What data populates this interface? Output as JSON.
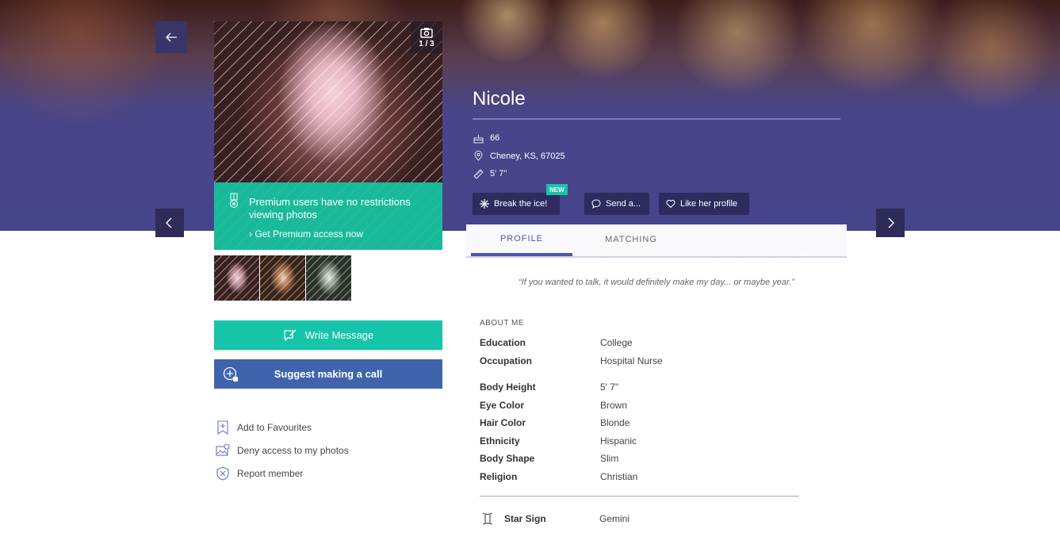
{
  "profile": {
    "name": "Nicole",
    "age": "66",
    "location": "Cheney, KS, 67025",
    "height": "5' 7\""
  },
  "photo": {
    "counter": "1 / 3",
    "thumbnail_count": 3
  },
  "premium": {
    "text": "Premium users have no restrictions viewing photos",
    "link": "Get Premium access now"
  },
  "buttons": {
    "write_message": "Write Message",
    "suggest_call": "Suggest making a call",
    "break_ice": "Break the ice!",
    "new_badge": "NEW",
    "send": "Send a...",
    "like": "Like her profile"
  },
  "actions": [
    {
      "label": "Add to Favourites",
      "icon": "bookmark-plus-icon"
    },
    {
      "label": "Deny access to my photos",
      "icon": "photo-lock-icon"
    },
    {
      "label": "Report member",
      "icon": "shield-x-icon"
    }
  ],
  "tabs": [
    {
      "label": "PROFILE",
      "active": true
    },
    {
      "label": "MATCHING",
      "active": false
    }
  ],
  "quote": "“If you wanted to talk, it would definitely make my day... or maybe year.”",
  "about": {
    "heading": "ABOUT ME",
    "group1": [
      {
        "key": "Education",
        "value": "College"
      },
      {
        "key": "Occupation",
        "value": "Hospital Nurse"
      }
    ],
    "group2": [
      {
        "key": "Body Height",
        "value": "5' 7\""
      },
      {
        "key": "Eye Color",
        "value": "Brown"
      },
      {
        "key": "Hair Color",
        "value": "Blonde"
      },
      {
        "key": "Ethnicity",
        "value": "Hispanic"
      },
      {
        "key": "Body Shape",
        "value": "Slim"
      },
      {
        "key": "Religion",
        "value": "Christian"
      }
    ],
    "star_sign": {
      "key": "Star Sign",
      "value": "Gemini",
      "icon": "gemini-icon"
    }
  },
  "colors": {
    "hero_blue": "#46448a",
    "teal": "#16c4aa",
    "call_blue": "#3f64ae",
    "dark_pill": "#2e2b5e",
    "tab_active": "#4c55b0"
  }
}
